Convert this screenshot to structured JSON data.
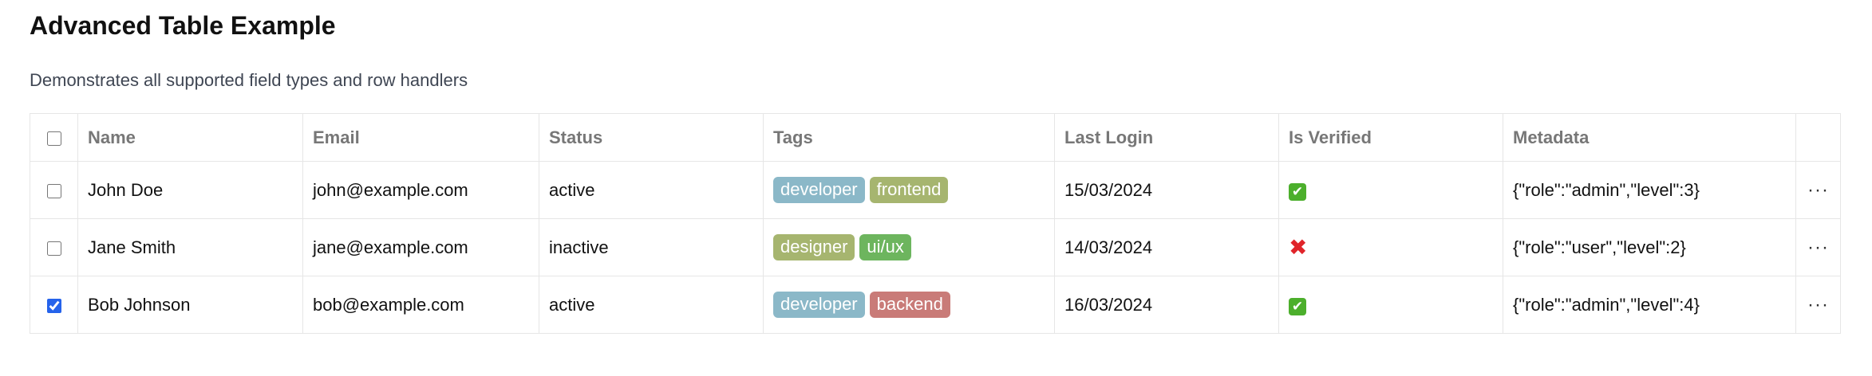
{
  "header": {
    "title": "Advanced Table Example",
    "subtitle": "Demonstrates all supported field types and row handlers"
  },
  "table": {
    "columns": [
      "Name",
      "Email",
      "Status",
      "Tags",
      "Last Login",
      "Is Verified",
      "Metadata"
    ],
    "rows": [
      {
        "checked": false,
        "name": "John Doe",
        "email": "john@example.com",
        "status": "active",
        "tags": [
          {
            "label": "developer",
            "color": "#8bb8c8"
          },
          {
            "label": "frontend",
            "color": "#a6b56f"
          }
        ],
        "last_login": "15/03/2024",
        "is_verified": true,
        "metadata": "{\"role\":\"admin\",\"level\":3}"
      },
      {
        "checked": false,
        "name": "Jane Smith",
        "email": "jane@example.com",
        "status": "inactive",
        "tags": [
          {
            "label": "designer",
            "color": "#a6b56f"
          },
          {
            "label": "ui/ux",
            "color": "#6db55e"
          }
        ],
        "last_login": "14/03/2024",
        "is_verified": false,
        "metadata": "{\"role\":\"user\",\"level\":2}"
      },
      {
        "checked": true,
        "name": "Bob Johnson",
        "email": "bob@example.com",
        "status": "active",
        "tags": [
          {
            "label": "developer",
            "color": "#8bb8c8"
          },
          {
            "label": "backend",
            "color": "#c97b78"
          }
        ],
        "last_login": "16/03/2024",
        "is_verified": true,
        "metadata": "{\"role\":\"admin\",\"level\":4}"
      }
    ],
    "verified_icons": {
      "true": "check-mark-icon",
      "false": "cross-mark-icon"
    },
    "actions_icon": "more-horizontal-icon",
    "actions_glyph": "···"
  }
}
